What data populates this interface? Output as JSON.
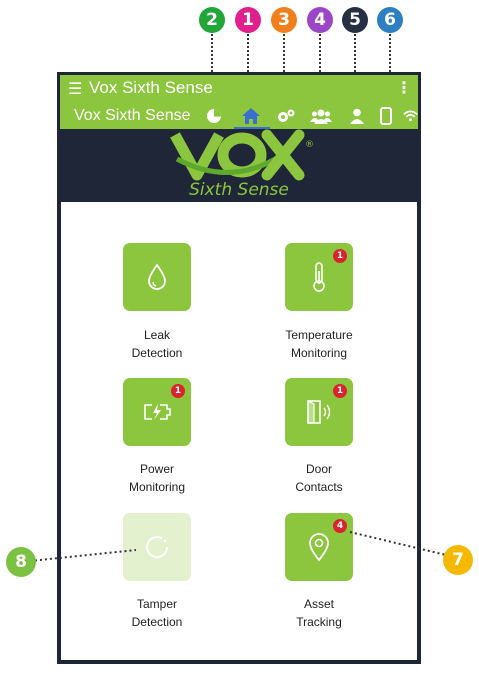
{
  "callouts": [
    {
      "number": "1",
      "color": "#e0208c"
    },
    {
      "number": "2",
      "color": "#22a63a"
    },
    {
      "number": "3",
      "color": "#f07f1e"
    },
    {
      "number": "4",
      "color": "#9b45c7"
    },
    {
      "number": "5",
      "color": "#253043"
    },
    {
      "number": "6",
      "color": "#2d7fc1"
    },
    {
      "number": "7",
      "color": "#f6b800"
    },
    {
      "number": "8",
      "color": "#7cc242"
    }
  ],
  "app": {
    "title": "Vox Sixth Sense",
    "subtitle": "Vox Sixth Sense",
    "accent": "#8cc63f",
    "header_bg": "#1f2638"
  },
  "nav": [
    {
      "icon": "pie-chart-icon"
    },
    {
      "icon": "home-icon",
      "active": true
    },
    {
      "icon": "settings-icon"
    },
    {
      "icon": "group-icon"
    },
    {
      "icon": "user-icon"
    },
    {
      "icon": "device-icon"
    },
    {
      "icon": "wifi-icon"
    }
  ],
  "logo": {
    "brand": "VOX",
    "registered": "®",
    "tagline": "Sixth Sense"
  },
  "tiles": [
    {
      "line1": "Leak",
      "line2": "Detection",
      "icon": "water-drop-icon",
      "badge": ""
    },
    {
      "line1": "Temperature",
      "line2": "Monitoring",
      "icon": "thermometer-icon",
      "badge": "1"
    },
    {
      "line1": "Power",
      "line2": "Monitoring",
      "icon": "battery-charging-icon",
      "badge": "1"
    },
    {
      "line1": "Door",
      "line2": "Contacts",
      "icon": "door-sensor-icon",
      "badge": "1"
    },
    {
      "line1": "Tamper",
      "line2": "Detection",
      "icon": "tamper-icon",
      "badge": "",
      "disabled": true
    },
    {
      "line1": "Asset",
      "line2": "Tracking",
      "icon": "location-pin-icon",
      "badge": "4"
    }
  ]
}
